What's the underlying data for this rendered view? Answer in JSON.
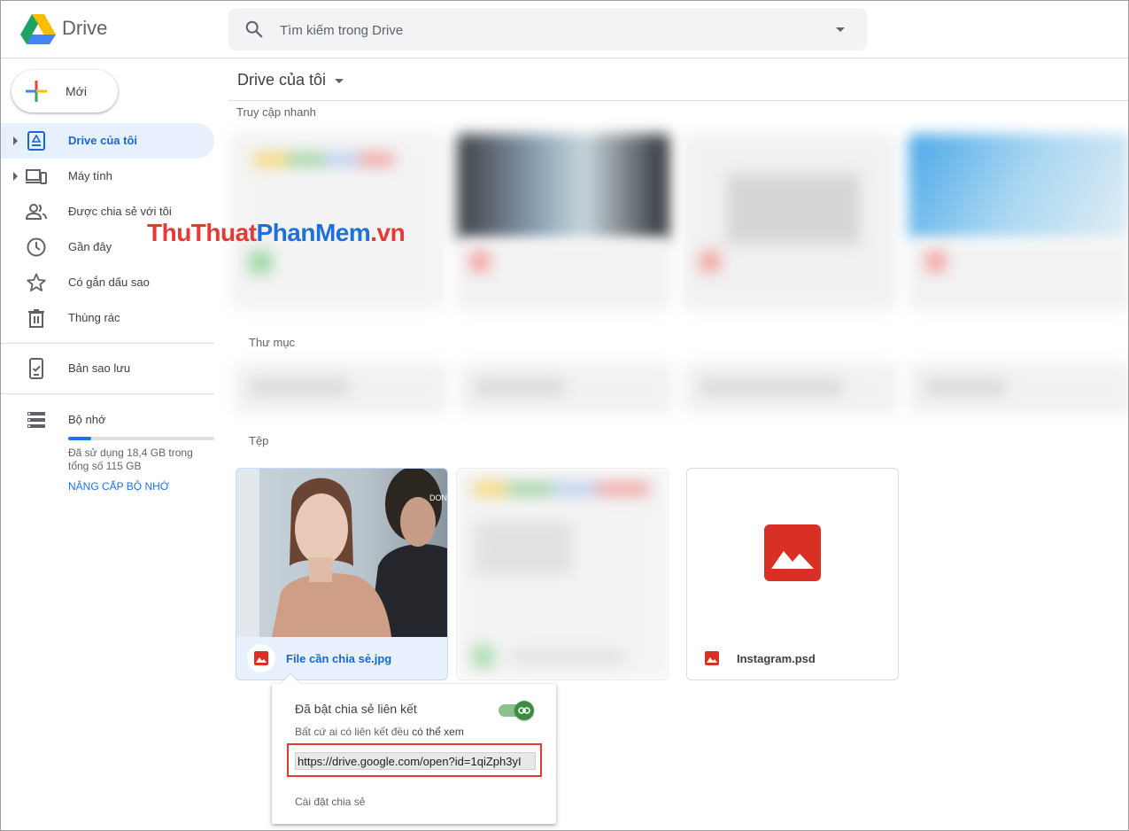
{
  "header": {
    "logo_text": "Drive",
    "search_placeholder": "Tìm kiếm trong Drive"
  },
  "sidebar": {
    "new_button": "Mới",
    "items": [
      {
        "label": "Drive của tôi",
        "icon": "my-drive-icon",
        "active": true
      },
      {
        "label": "Máy tính",
        "icon": "computers-icon"
      },
      {
        "label": "Được chia sẻ với tôi",
        "icon": "shared-people-icon"
      },
      {
        "label": "Gần đây",
        "icon": "clock-icon"
      },
      {
        "label": "Có gắn dấu sao",
        "icon": "star-icon"
      },
      {
        "label": "Thùng rác",
        "icon": "trash-icon"
      },
      {
        "label": "Bản sao lưu",
        "icon": "backup-icon"
      },
      {
        "label": "Bộ nhớ",
        "icon": "storage-icon"
      }
    ],
    "storage": {
      "used_fraction": 0.16,
      "text": "Đã sử dụng 18,4 GB trong tổng số 115 GB",
      "upgrade": "NÂNG CẤP BỘ NHỚ"
    }
  },
  "main": {
    "title": "Drive của tôi",
    "quick_access": "Truy cập nhanh",
    "folders": "Thư mục",
    "files": "Tệp",
    "file_cards": [
      {
        "name": "File cần chia sẻ.jpg",
        "icon": "image-file-icon",
        "selected": true
      },
      {
        "name": "",
        "icon": "blurred-file-icon"
      },
      {
        "name": "Instagram.psd",
        "icon": "image-file-icon"
      }
    ]
  },
  "watermark": {
    "part1": "ThuThuat",
    "part2": "PhanMem",
    "part3": ".vn"
  },
  "share_popup": {
    "title": "Đã bật chia sẻ liên kết",
    "subtitle_prefix": "Bất cứ ai có liên kết đều",
    "subtitle_emphasis": "có thể xem",
    "link": "https://drive.google.com/open?id=1qiZph3yI",
    "settings": "Cài đặt chia sẻ"
  },
  "colors": {
    "accent": "#1a73e8",
    "active_bg": "#e8f0fe",
    "file_red": "#d93025",
    "highlight_red": "#e53935",
    "toggle_green": "#3c8d3f"
  }
}
